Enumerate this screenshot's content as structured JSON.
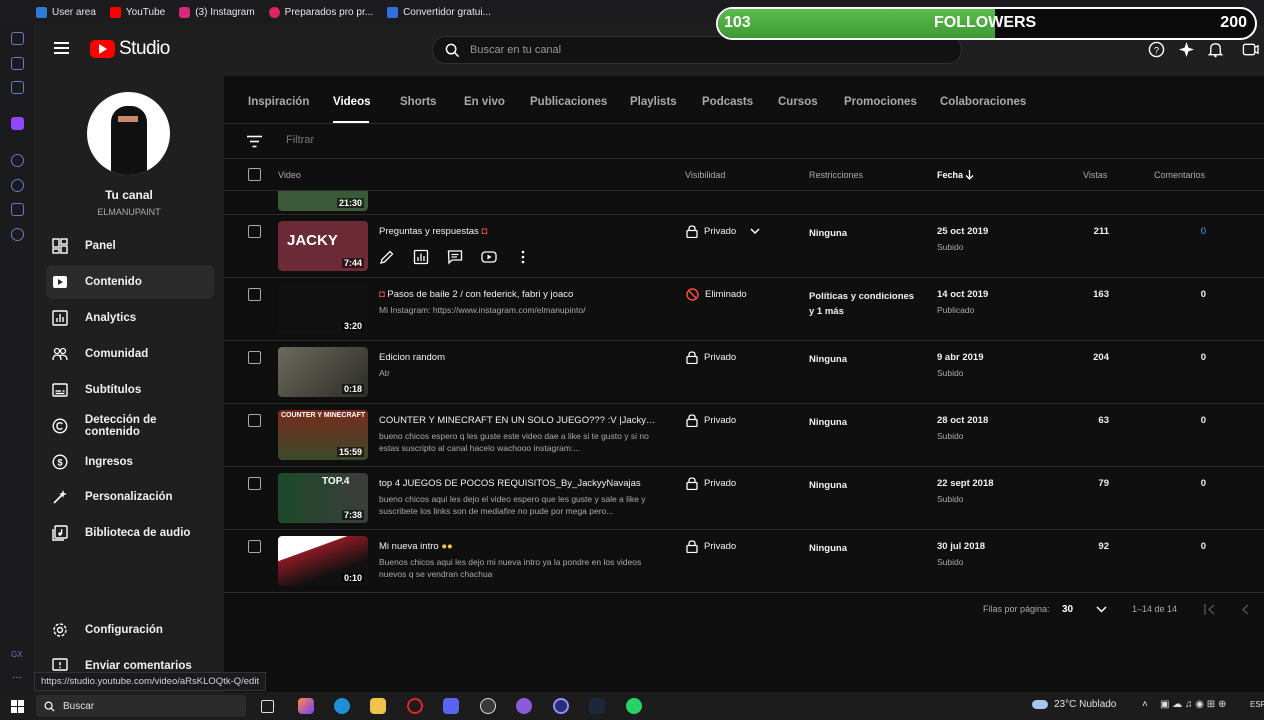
{
  "bookmarks": [
    {
      "label": "User area",
      "icon": "tl-icon",
      "color": "#2e7bd6"
    },
    {
      "label": "YouTube",
      "icon": "youtube-icon",
      "color": "#ff0000"
    },
    {
      "label": "(3) Instagram",
      "icon": "instagram-icon",
      "color": "#d6297a"
    },
    {
      "label": "Preparados pro pr...",
      "icon": "bookmark-icon",
      "color": "#e0245e"
    },
    {
      "label": "Convertidor gratui...",
      "icon": "converter-icon",
      "color": "#2f6fdd"
    }
  ],
  "overlay": {
    "current": "103",
    "label": "FOLLOWERS",
    "goal": "200",
    "progress": 0.515,
    "fill_color": "#4caf3f"
  },
  "header": {
    "app_name": "Studio",
    "search_placeholder": "Buscar en tu canal"
  },
  "channel": {
    "title": "Tu canal",
    "handle": "ELMANUPAINT"
  },
  "nav": [
    {
      "label": "Panel",
      "icon": "dashboard-icon",
      "active": false
    },
    {
      "label": "Contenido",
      "icon": "content-icon",
      "active": true
    },
    {
      "label": "Analytics",
      "icon": "analytics-icon",
      "active": false
    },
    {
      "label": "Comunidad",
      "icon": "community-icon",
      "active": false
    },
    {
      "label": "Subtítulos",
      "icon": "subtitles-icon",
      "active": false
    },
    {
      "label": "Detección de contenido",
      "icon": "copyright-icon",
      "active": false
    },
    {
      "label": "Ingresos",
      "icon": "earn-icon",
      "active": false
    },
    {
      "label": "Personalización",
      "icon": "customization-icon",
      "active": false
    },
    {
      "label": "Biblioteca de audio",
      "icon": "audio-library-icon",
      "active": false
    }
  ],
  "nav_bottom": [
    {
      "label": "Configuración",
      "icon": "settings-icon"
    },
    {
      "label": "Enviar comentarios",
      "icon": "feedback-icon"
    }
  ],
  "tabs": [
    {
      "label": "Inspiración",
      "active": false
    },
    {
      "label": "Videos",
      "active": true
    },
    {
      "label": "Shorts",
      "active": false
    },
    {
      "label": "En vivo",
      "active": false
    },
    {
      "label": "Publicaciones",
      "active": false
    },
    {
      "label": "Playlists",
      "active": false
    },
    {
      "label": "Podcasts",
      "active": false
    },
    {
      "label": "Cursos",
      "active": false
    },
    {
      "label": "Promociones",
      "active": false
    },
    {
      "label": "Colaboraciones",
      "active": false
    }
  ],
  "filter": {
    "placeholder": "Filtrar"
  },
  "columns": {
    "video": "Video",
    "visibility": "Visibilidad",
    "restrictions": "Restricciones",
    "date": "Fecha",
    "views": "Vistas",
    "comments": "Comentarios"
  },
  "partial_row": {
    "duration": "21:30"
  },
  "videos": [
    {
      "title": "Preguntas y respuestas",
      "description": "",
      "duration": "7:44",
      "visibility": "Privado",
      "restrictions": "Ninguna",
      "date": "25 oct 2019",
      "status": "Subido",
      "views": "211",
      "comments": "0",
      "thumb_color": "#6b2a36",
      "thumb_text": "JACKY"
    },
    {
      "title": "Pasos de baile 2 / con federick, fabri y joaco",
      "description": "Mi Instagram: https://www.instagram.com/elmanupinto/",
      "duration": "3:20",
      "visibility": "Eliminado",
      "restrictions": "Políticas y condiciones y 1 más",
      "date": "14 oct 2019",
      "status": "Publicado",
      "views": "163",
      "comments": "0",
      "thumb_color": "#111111",
      "thumb_text": ""
    },
    {
      "title": "Edicion random",
      "description": "Atr",
      "duration": "0:18",
      "visibility": "Privado",
      "restrictions": "Ninguna",
      "date": "9 abr 2019",
      "status": "Subido",
      "views": "204",
      "comments": "0",
      "thumb_color": "#4a4a42",
      "thumb_text": ""
    },
    {
      "title": "COUNTER Y MINECRAFT EN UN SOLO JUEGO??? :V |JackyyNa...",
      "description": "bueno chicos espero q les guste este video dae a like si te gusto y si no estas suscripto al canal hacelo wachooo instagram:...",
      "duration": "15:59",
      "visibility": "Privado",
      "restrictions": "Ninguna",
      "date": "28 oct 2018",
      "status": "Subido",
      "views": "63",
      "comments": "0",
      "thumb_color": "#7a2b1e",
      "thumb_text": "COUNTER Y MINECRAFT"
    },
    {
      "title": "top 4 JUEGOS DE POCOS REQUISITOS_By_JackyyNavajas",
      "description": "bueno chicos aqui les dejo el video espero que les guste y sale a like y suscribete los links son de mediafire no pude por mega pero...",
      "duration": "7:38",
      "visibility": "Privado",
      "restrictions": "Ninguna",
      "date": "22 sept 2018",
      "status": "Subido",
      "views": "79",
      "comments": "0",
      "thumb_color": "#1d4a2a",
      "thumb_text": "TOP.4"
    },
    {
      "title": "Mi nueva intro",
      "description": "Buenos chicos aqui les dejo mi nueva intro ya la pondre en los videos nuevos q se vendran chachua",
      "duration": "0:10",
      "visibility": "Privado",
      "restrictions": "Ninguna",
      "date": "30 jul 2018",
      "status": "Subido",
      "views": "92",
      "comments": "0",
      "thumb_color": "#8a1a24",
      "thumb_text": ""
    }
  ],
  "pager": {
    "rows_label": "Filas por página:",
    "rows_value": "30",
    "range": "1–14 de 14"
  },
  "status_url": "https://studio.youtube.com/video/aRsKLOQtk-Q/edit",
  "taskbar": {
    "search": "Buscar",
    "weather": "23°C  Nublado",
    "lang": "ESP"
  }
}
